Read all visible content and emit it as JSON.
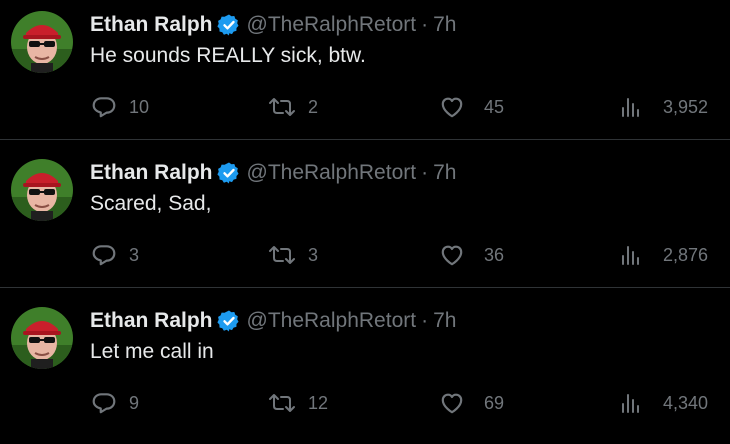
{
  "tweets": [
    {
      "author_name": "Ethan Ralph",
      "handle": "@TheRalphRetort",
      "separator": "·",
      "time": "7h",
      "text": "He sounds REALLY sick, btw.",
      "replies": "10",
      "retweets": "2",
      "likes": "45",
      "views": "3,952"
    },
    {
      "author_name": "Ethan Ralph",
      "handle": "@TheRalphRetort",
      "separator": "·",
      "time": "7h",
      "text": "Scared, Sad,",
      "replies": "3",
      "retweets": "3",
      "likes": "36",
      "views": "2,876"
    },
    {
      "author_name": "Ethan Ralph",
      "handle": "@TheRalphRetort",
      "separator": "·",
      "time": "7h",
      "text": "Let me call in",
      "replies": "9",
      "retweets": "12",
      "likes": "69",
      "views": "4,340"
    }
  ],
  "icons": {
    "verified": "verified-badge-icon",
    "reply": "reply-icon",
    "retweet": "retweet-icon",
    "like": "heart-icon",
    "views": "views-chart-icon"
  },
  "colors": {
    "background": "#000000",
    "text_primary": "#e7e9ea",
    "text_secondary": "#71767b",
    "verified_blue": "#1d9bf0",
    "divider": "#2f3336"
  }
}
